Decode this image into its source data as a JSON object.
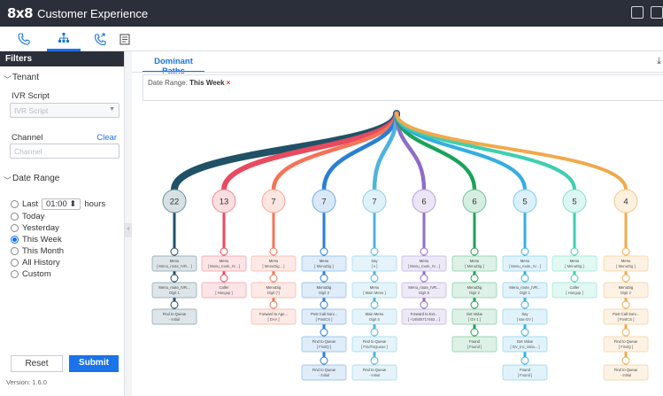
{
  "app": {
    "logo": "8x8",
    "name": "Customer Experience"
  },
  "toolbar": {
    "icons": [
      "phone-icon",
      "hierarchy-icon",
      "callback-icon",
      "report-icon"
    ],
    "active": "hierarchy-icon"
  },
  "sidebar": {
    "title": "Filters",
    "tenant": {
      "title": "Tenant",
      "ivr_label": "IVR Script",
      "ivr_placeholder": "IVR Script"
    },
    "channel": {
      "label": "Channel",
      "clear": "Clear",
      "placeholder": "Channel"
    },
    "date_range": {
      "title": "Date Range",
      "last_label": "Last",
      "last_value": "01:00",
      "last_unit": "hours",
      "options": [
        "Today",
        "Yesterday",
        "This Week",
        "This Month",
        "All History",
        "Custom"
      ],
      "selected": "This Week"
    },
    "reset": "Reset",
    "submit": "Submit",
    "version": "Version: 1.6.0"
  },
  "main": {
    "tab": "Dominant Paths",
    "date_range_label": "Date Range:",
    "date_range_value": "This Week",
    "remove": "×",
    "paths": [
      {
        "count": "22",
        "color": "#1f5266",
        "nodes": [
          [
            "Menu",
            "[ Menu_route_IVR... ]"
          ],
          [
            "Menu_route_IVR...",
            "Digit 1"
          ],
          [
            "Find to Queue",
            "- Initial"
          ]
        ]
      },
      {
        "count": "13",
        "color": "#e84a5f",
        "nodes": [
          [
            "Menu",
            "[ Menu_route_IV... ]"
          ],
          [
            "Caller",
            "[ Hangup ]"
          ]
        ]
      },
      {
        "count": "7",
        "color": "#f47458",
        "nodes": [
          [
            "Menu",
            "[ MenuDig... ]"
          ],
          [
            "MenuDig",
            "Digit (*)"
          ],
          [
            "Forward to Age...",
            "[ DAA ]"
          ]
        ]
      },
      {
        "count": "7",
        "color": "#2a7fd4",
        "nodes": [
          [
            "Menu",
            "[ MenuDig ]"
          ],
          [
            "MenuDig",
            "Digit 2"
          ],
          [
            "Post Call Surv...",
            "[ PostCS ]"
          ],
          [
            "Find to Queue",
            "[ FindQ ]"
          ],
          [
            "Find to Queue",
            "- Initial"
          ]
        ]
      },
      {
        "count": "7",
        "color": "#4fb3e0",
        "nodes": [
          [
            "Say",
            "[ s ]"
          ],
          [
            "Menu",
            "[ Main Menu ]"
          ],
          [
            "Main Menu",
            "Digit 0"
          ],
          [
            "Find to Queue",
            "[ FindToQueue ]"
          ],
          [
            "Find to Queue",
            "- Initial"
          ]
        ]
      },
      {
        "count": "6",
        "color": "#8e6cc8",
        "nodes": [
          [
            "Menu",
            "[ Menu_route_IV... ]"
          ],
          [
            "Menu_route_IVR...",
            "Digit 8"
          ],
          [
            "Forward to Ext...",
            "[ +16505717462... ]"
          ]
        ]
      },
      {
        "count": "6",
        "color": "#1aa35a",
        "nodes": [
          [
            "Menu",
            "[ MenuDig ]"
          ],
          [
            "MenuDig",
            "Digit 2"
          ],
          [
            "Get Value",
            "[ GV 1 ]"
          ],
          [
            "Found",
            "[ Found ]"
          ]
        ]
      },
      {
        "count": "5",
        "color": "#35aee0",
        "nodes": [
          [
            "Menu",
            "[ Menu_route_IV... ]"
          ],
          [
            "Menu_route_IVR...",
            "Digit 1"
          ],
          [
            "Say",
            "[ sas-GV ]"
          ],
          [
            "Get Value",
            "[ GV_Inc_initia... ]"
          ],
          [
            "Found",
            "[ Found ]"
          ]
        ]
      },
      {
        "count": "5",
        "color": "#3ecfb0",
        "nodes": [
          [
            "Menu",
            "[ MenuDig ]"
          ],
          [
            "Caller",
            "[ Hangup ]"
          ]
        ]
      },
      {
        "count": "4",
        "color": "#f0a94b",
        "nodes": [
          [
            "Menu",
            "[ MenuDig ]"
          ],
          [
            "MenuDig",
            "Digit 2"
          ],
          [
            "Post Call Surv...",
            "[ PostCS ]"
          ],
          [
            "Find to Queue",
            "[ FindQ ]"
          ],
          [
            "Find to Queue",
            "- Initial"
          ]
        ]
      }
    ]
  }
}
